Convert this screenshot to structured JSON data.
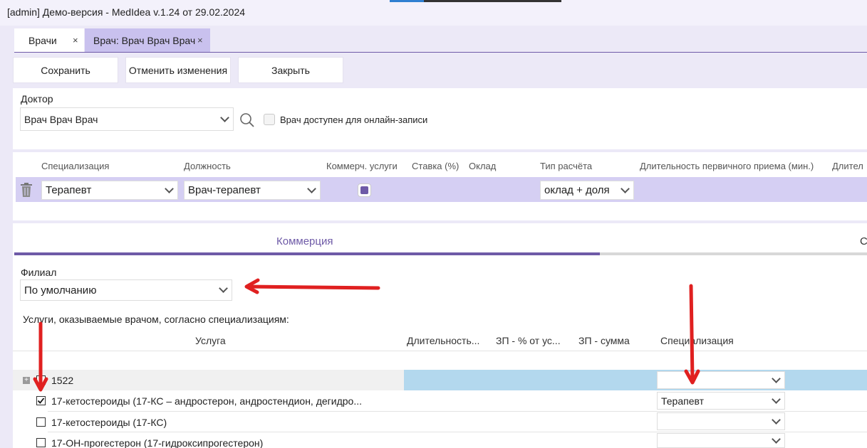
{
  "window": {
    "title": "[admin] Демо-версия  - MedIdea v.1.24 от 29.02.2024"
  },
  "tabs": [
    {
      "label": "Врачи",
      "close": "×"
    },
    {
      "label": "Врач: Врач Врач Врач",
      "close": "×"
    }
  ],
  "toolbar": {
    "save_label": "Сохранить",
    "cancel_label": "Отменить изменения",
    "close_label": "Закрыть"
  },
  "doctor": {
    "label": "Доктор",
    "value": "Врач Врач Врач",
    "online_label": "Врач доступен для онлайн-записи",
    "online_checked": false
  },
  "specializations": {
    "columns": [
      "Специализация",
      "Должность",
      "Коммерч. услуги",
      "Ставка (%)",
      "Оклад",
      "Тип расчёта",
      "Длительность первичного приема (мин.)",
      "Длител"
    ],
    "row": {
      "specialization": "Терапевт",
      "position": "Врач-терапевт",
      "commercial": true,
      "calc_type": "оклад + доля"
    }
  },
  "commerce": {
    "tab_active": "Коммерция",
    "tab_next": "С",
    "branch_label": "Филиал",
    "branch_value": "По умолчанию",
    "services_caption": "Услуги, оказываемые врачом, согласно специализациям:",
    "columns": [
      "Услуга",
      "Длительность...",
      "ЗП - % от ус...",
      "ЗП - сумма",
      "Специализация"
    ],
    "rows": [
      {
        "expander": "+",
        "name": "1522",
        "checked": false,
        "specialization": ""
      },
      {
        "name": "17-кетостероиды (17-КС – андростерон, андростендион, дегидро...",
        "checked": true,
        "specialization": "Терапевт"
      },
      {
        "name": "17-кетостероиды (17-КС)",
        "checked": false,
        "specialization": ""
      },
      {
        "name": "17-ОН-прогестерон (17-гидроксипрогестерон)",
        "checked": false,
        "specialization": ""
      }
    ]
  },
  "colors": {
    "accent": "#6e5aa7",
    "selected_tab": "#c9c1ee",
    "spec_row": "#d5cff3",
    "group_row": "#b3d8ee",
    "annotation_arrow": "#e02020"
  }
}
